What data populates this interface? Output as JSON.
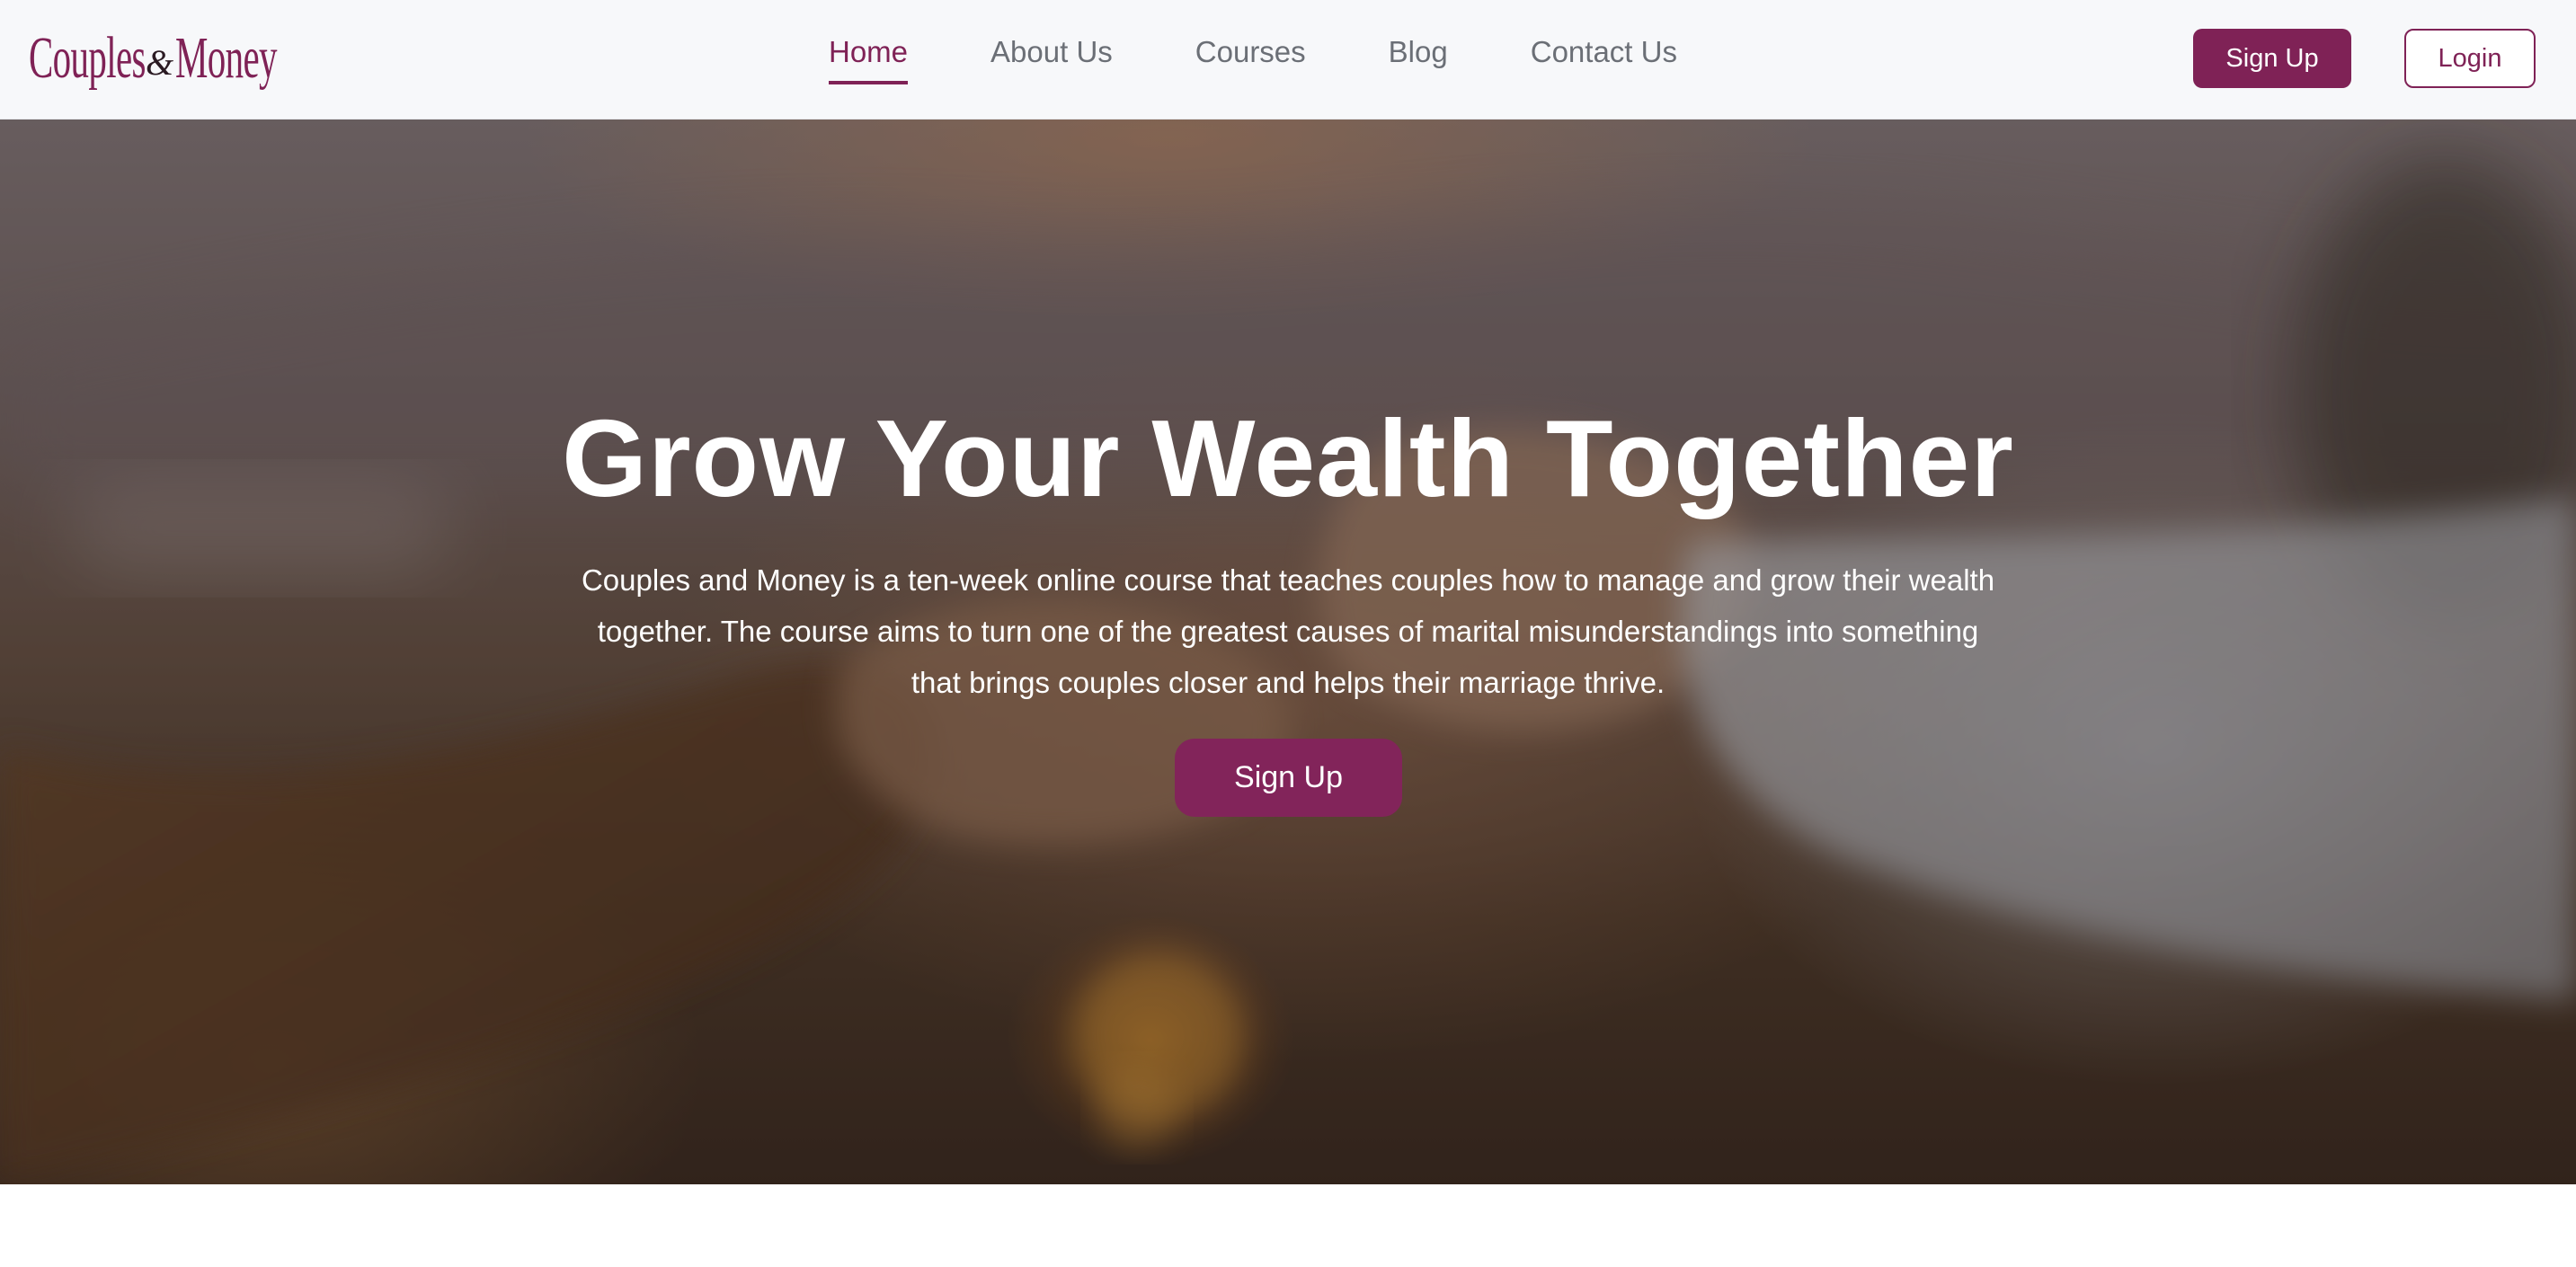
{
  "brand": {
    "logo_part1": "Couples",
    "logo_amp": "&",
    "logo_part2": "Money",
    "primary_color": "#7f2256"
  },
  "nav": {
    "links": [
      {
        "label": "Home",
        "active": true
      },
      {
        "label": "About Us",
        "active": false
      },
      {
        "label": "Courses",
        "active": false
      },
      {
        "label": "Blog",
        "active": false
      },
      {
        "label": "Contact Us",
        "active": false
      }
    ],
    "signup_label": "Sign Up",
    "login_label": "Login"
  },
  "hero": {
    "title": "Grow Your Wealth Together",
    "description": "Couples and Money is a ten-week online course that teaches couples how to manage and grow their wealth together. The course aims to turn one of the greatest causes of marital misunderstandings into something that brings couples closer and helps their marriage thrive.",
    "cta_label": "Sign Up"
  }
}
